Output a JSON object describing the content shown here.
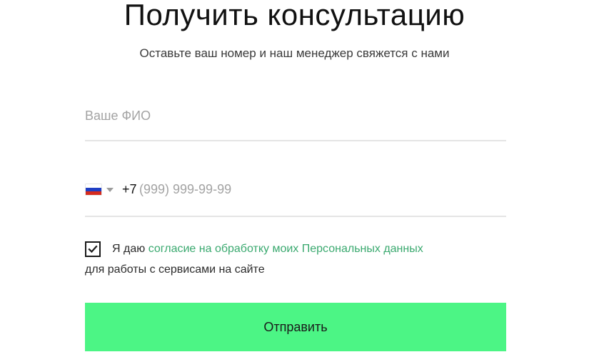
{
  "header": {
    "title": "Получить консультацию",
    "subtitle": "Оставьте ваш номер и наш менеджер свяжется с нами"
  },
  "form": {
    "name_field": {
      "value": "",
      "placeholder": "Ваше ФИО"
    },
    "phone_field": {
      "country_flag_icon": "russia-flag-icon",
      "dial_code": "+7",
      "value": "",
      "placeholder": "(999) 999-99-99"
    },
    "consent": {
      "checked": true,
      "text_before": "Я даю ",
      "link_text": "согласие на обработку моих Персональных данных",
      "text_after": "для работы с сервисами на сайте"
    },
    "submit_label": "Отправить"
  },
  "colors": {
    "accent": "#4cf585",
    "link": "#3aa96f",
    "divider": "#e4e4e4"
  }
}
